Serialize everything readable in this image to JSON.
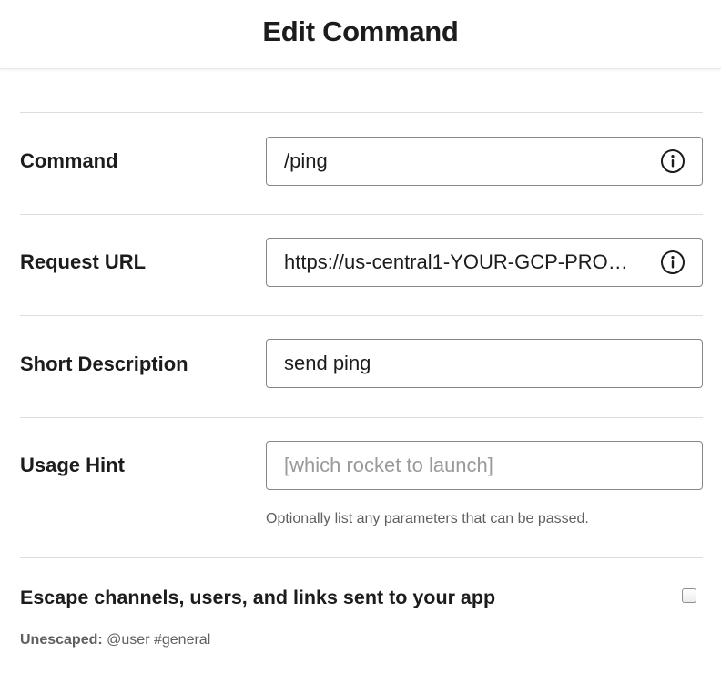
{
  "header": {
    "title": "Edit Command"
  },
  "form": {
    "command": {
      "label": "Command",
      "value": "/ping",
      "icon": "info-icon"
    },
    "request_url": {
      "label": "Request URL",
      "value": "https://us-central1-YOUR-GCP-PRO…",
      "icon": "info-icon"
    },
    "short_description": {
      "label": "Short Description",
      "value": "send ping"
    },
    "usage_hint": {
      "label": "Usage Hint",
      "value": "",
      "placeholder": "[which rocket to launch]",
      "help": "Optionally list any parameters that can be passed."
    },
    "escape": {
      "label": "Escape channels, users, and links sent to your app",
      "checked": false,
      "example_label": "Unescaped:",
      "example_value": "@user #general"
    }
  }
}
